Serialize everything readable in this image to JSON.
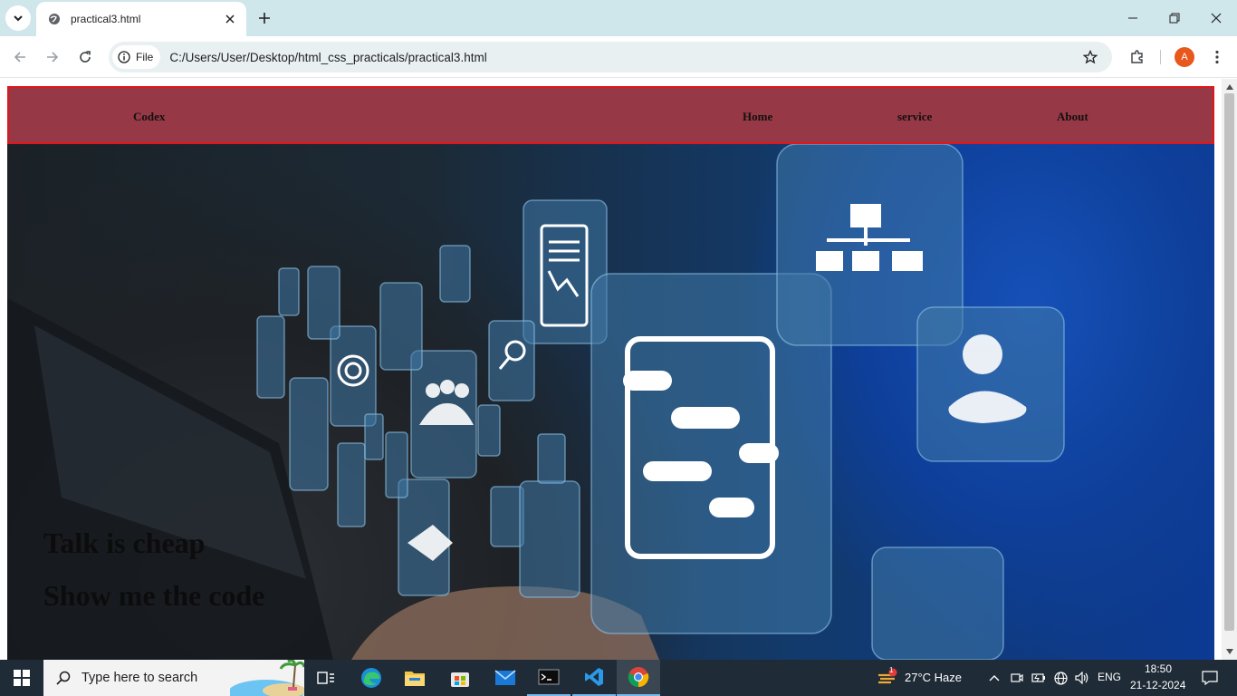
{
  "browser": {
    "tab_title": "practical3.html",
    "chip_label": "File",
    "url": "C:/Users/User/Desktop/html_css_practicals/practical3.html",
    "profile_initial": "A"
  },
  "page": {
    "nav": {
      "brand": "Codex",
      "links": [
        "Home",
        "service",
        "About"
      ]
    },
    "hero": {
      "line1": "Talk is cheap",
      "line2": "Show me the code"
    }
  },
  "taskbar": {
    "search_placeholder": "Type here to search",
    "weather_badge": "1",
    "weather": "27°C  Haze",
    "language": "ENG",
    "time": "18:50",
    "date": "21-12-2024"
  },
  "colors": {
    "nav_background": "#963845",
    "nav_border": "#e0161c",
    "taskbar": "#1f2b36"
  }
}
